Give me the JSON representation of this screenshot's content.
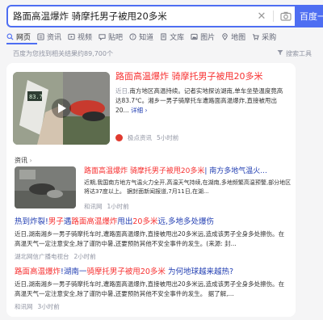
{
  "search": {
    "query": "路面高温爆炸 骑摩托男子被甩20多米",
    "button_label": "百度一"
  },
  "tabs": [
    {
      "label": "网页",
      "icon": "web-page-icon",
      "active": true
    },
    {
      "label": "资讯",
      "icon": "news-icon"
    },
    {
      "label": "视频",
      "icon": "video-icon"
    },
    {
      "label": "贴吧",
      "icon": "tieba-icon"
    },
    {
      "label": "知道",
      "icon": "zhidao-icon"
    },
    {
      "label": "文库",
      "icon": "wenku-icon"
    },
    {
      "label": "图片",
      "icon": "image-icon"
    },
    {
      "label": "地图",
      "icon": "map-icon"
    },
    {
      "label": "采购",
      "icon": "purchase-icon"
    }
  ],
  "result_count": "百度为您找到相关结果约89,700个",
  "tools_label": "搜索工具",
  "results": {
    "r1": {
      "title": "路面高温爆炸 骑摩托男子被甩20多米",
      "abstract_date": "近日,",
      "abstract": "南方地区高温持续。记者实地探访湖南,单车坐垫温度竟高达83.7℃。湘乡一男子骑摩托车遭路面高温爆炸,直接被甩出20...",
      "more": "详细 ›",
      "source": "极点资讯",
      "time": "5小时前"
    },
    "section_label": "资讯",
    "r2": {
      "title_red": "路面高温爆炸 骑摩托男子被甩20多米",
      "title_blue": "| 南方多地气温火...",
      "abstract": "近期,我国南方地方气温火力全开,高温天气持续,在湖南,多地频繁高温预警,部分地区将达37度以上。 据封面新闻报道,7月11日,在湖...",
      "source": "和讯网",
      "time": "1小时前"
    },
    "r3": {
      "title_blue1": "热到炸裂!",
      "title_red1": "男子",
      "title_blue2": "遇",
      "title_red2": "路面高温爆炸",
      "title_blue3": "甩出",
      "title_red3": "20多米",
      "title_blue4": "远,多地多处爆伤",
      "abstract": "近日,湖南湘乡一男子骑摩托车时,遭路面高温爆炸,直接被甩出20多米远,造成该男子全身多处擦伤。在高温天气一定注意安全,除了谨防中暑,还要预防其他不安全事件的发生。(来源: 封...",
      "source": "湖北网信广播电视台",
      "time": "2小时前"
    },
    "r4": {
      "title_red": "路面高温爆炸",
      "title_blue1": "!湖南一",
      "title_red2": "骑摩托男子被甩20多米",
      "title_blue2": " 为何地球越来越热?",
      "abstract": "近日,湖南湘乡一男子骑摩托车时,遭路面高温爆炸,直接被甩出20多米远,造成该男子全身多处擦伤。在高温天气一定注意安全,除了谨防中暑,还要预防其他不安全事件的发生。 据了解,...",
      "source": "和讯网",
      "time": "3小时前"
    }
  }
}
